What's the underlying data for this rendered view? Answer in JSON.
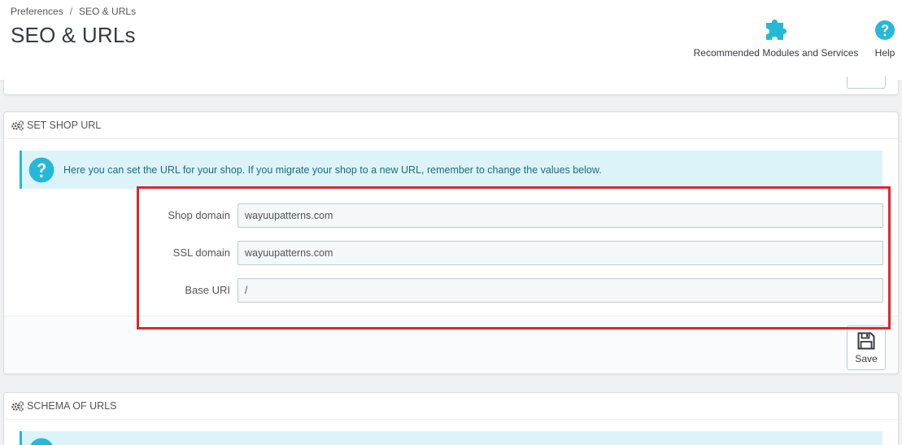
{
  "breadcrumb": {
    "parent": "Preferences",
    "separator": "/",
    "current": "SEO & URLs"
  },
  "page_title": "SEO & URLs",
  "toolbar": {
    "modules_label": "Recommended Modules and Services",
    "modules_icon": "puzzle-icon",
    "help_label": "Help",
    "help_icon": "question-circle-icon"
  },
  "shop_url_panel": {
    "heading": "SET SHOP URL",
    "alert": "Here you can set the URL for your shop. If you migrate your shop to a new URL, remember to change the values below.",
    "fields": {
      "shop_domain": {
        "label": "Shop domain",
        "value": "wayuupatterns.com"
      },
      "ssl_domain": {
        "label": "SSL domain",
        "value": "wayuupatterns.com"
      },
      "base_uri": {
        "label": "Base URI",
        "value": "/"
      }
    },
    "save_label": "Save"
  },
  "schema_panel": {
    "heading": "SCHEMA OF URLS"
  },
  "colors": {
    "accent": "#25b9d7",
    "alert_bg": "#dcf4f9",
    "highlight": "#e0262e",
    "title": "#363a41"
  }
}
